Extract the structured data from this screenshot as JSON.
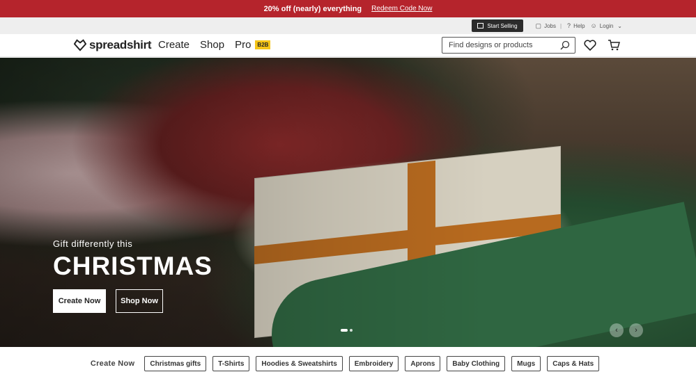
{
  "promo": {
    "headline": "20% off (nearly) everything",
    "cta": "Redeem Code Now",
    "background": "#b5242c"
  },
  "utility": {
    "start_selling": "Start Selling",
    "jobs": "Jobs",
    "help": "Help",
    "login": "Login"
  },
  "nav": {
    "brand": "spreadshirt",
    "links": [
      "Create",
      "Shop",
      "Pro"
    ],
    "pro_badge": "B2B",
    "search_placeholder": "Find designs or products"
  },
  "hero": {
    "subtitle": "Gift differently this",
    "title": "CHRISTMAS",
    "primary_cta": "Create Now",
    "secondary_cta": "Shop Now",
    "slides": 2,
    "active_slide": 1
  },
  "categories": {
    "title": "Create Now",
    "items": [
      "Christmas gifts",
      "T-Shirts",
      "Hoodies & Sweatshirts",
      "Embroidery",
      "Aprons",
      "Baby Clothing",
      "Mugs",
      "Caps & Hats"
    ]
  },
  "icons": {
    "search": "search-icon",
    "wishlist": "heart-icon",
    "cart": "cart-icon",
    "user": "user-icon",
    "help": "help-icon",
    "jobs": "briefcase-icon",
    "store": "store-icon"
  }
}
